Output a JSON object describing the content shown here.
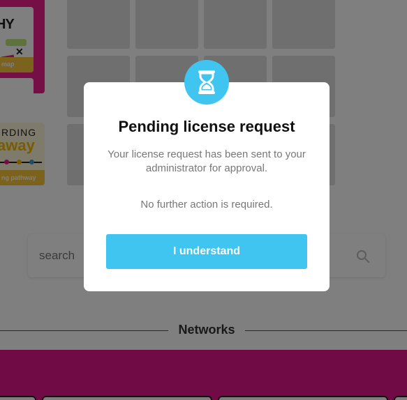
{
  "background": {
    "card_1_label": "map",
    "card_1_art_text": "HY",
    "card_2_top_text": "RDING",
    "card_2_art_text": "away",
    "card_2_label": "ng pathway",
    "search": {
      "placeholder": "search"
    },
    "section_heading": "Networks"
  },
  "modal": {
    "icon": "hourglass-icon",
    "title": "Pending license request",
    "body": "Your license request has been sent to your administrator for approval.",
    "note": "No further action is required.",
    "button_label": "I understand"
  },
  "colors": {
    "accent": "#40c4f0",
    "brand_magenta": "#e0168b",
    "card_yellow": "#f7c43b"
  }
}
